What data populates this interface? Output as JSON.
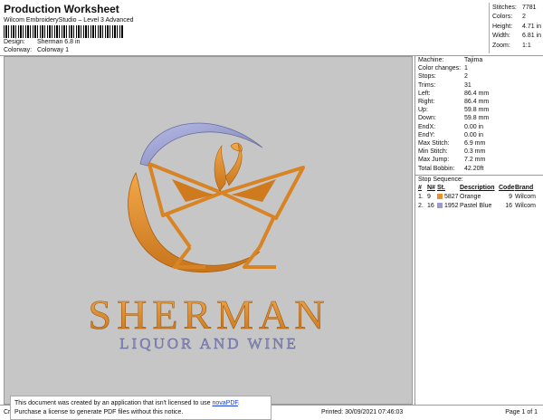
{
  "header": {
    "title": "Production Worksheet",
    "subtitle": "Wilcom EmbroideryStudio – Level 3 Advanced",
    "design_label": "Design:",
    "design_value": "Sherman 6.8 in",
    "colorway_label": "Colorway:",
    "colorway_value": "Colorway 1"
  },
  "stats": [
    {
      "k": "Stitches:",
      "v": "7781"
    },
    {
      "k": "Colors:",
      "v": "2"
    },
    {
      "k": "Height:",
      "v": "4.71 in"
    },
    {
      "k": "Width:",
      "v": "6.81 in"
    },
    {
      "k": "Zoom:",
      "v": "1:1"
    }
  ],
  "machine": [
    {
      "k": "Machine:",
      "v": "Tajima"
    },
    {
      "k": "Color changes:",
      "v": "1"
    },
    {
      "k": "Stops:",
      "v": "2"
    },
    {
      "k": "Trims:",
      "v": "31"
    },
    {
      "k": "Left:",
      "v": "86.4 mm"
    },
    {
      "k": "Right:",
      "v": "86.4 mm"
    },
    {
      "k": "Up:",
      "v": "59.8 mm"
    },
    {
      "k": "Down:",
      "v": "59.8 mm"
    },
    {
      "k": "EndX:",
      "v": "0.00 in"
    },
    {
      "k": "EndY:",
      "v": "0.00 in"
    },
    {
      "k": "Max Stitch:",
      "v": "6.9 mm"
    },
    {
      "k": "Min Stitch:",
      "v": "0.3 mm"
    },
    {
      "k": "Max Jump:",
      "v": "7.2 mm"
    },
    {
      "k": "Total Bobbin:",
      "v": "42.20ft"
    }
  ],
  "stop_sequence": {
    "title": "Stop Sequence:",
    "headers": {
      "num": "#",
      "n": "N#",
      "st": "St.",
      "desc": "Description",
      "code": "Code",
      "brand": "Brand"
    },
    "rows": [
      {
        "num": "1.",
        "n": "9",
        "st": "5827",
        "desc": "Orange",
        "code": "9",
        "brand": "Wilcom",
        "color": "#e8902a"
      },
      {
        "num": "2.",
        "n": "16",
        "st": "1952",
        "desc": "Pastel Blue",
        "code": "16",
        "brand": "Wilcom",
        "color": "#9c9cc8"
      }
    ]
  },
  "artwork": {
    "name": "SHERMAN",
    "tagline": "LIQUOR AND WINE",
    "orange": "#e08a28",
    "blue": "#9a9ed0",
    "canvas_bg": "#c6c6c6"
  },
  "footer": {
    "left": "Cr",
    "printed": "Printed: 30/09/2021 07:46:03",
    "page": "Page 1 of 1"
  },
  "notice": {
    "line1_pre": "This document was created by an application that isn't licensed to use ",
    "link": "novaPDF",
    "line1_post": ".",
    "line2": "Purchase a license to generate PDF files without this notice."
  }
}
